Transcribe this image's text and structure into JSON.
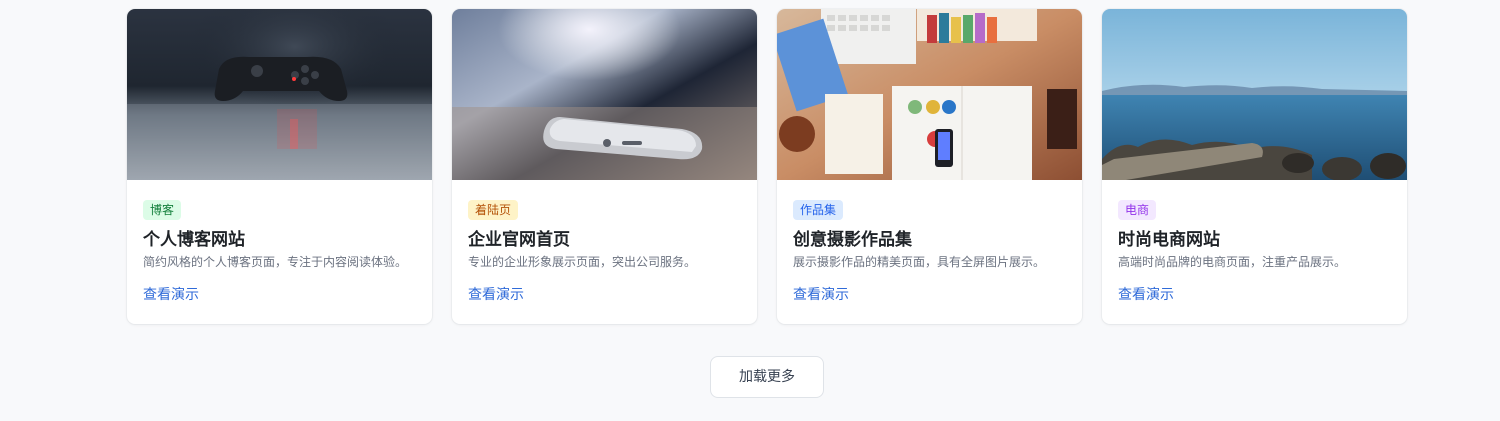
{
  "cards": [
    {
      "tag": "博客",
      "tag_bg": "#dcfce7",
      "tag_fg": "#15803d",
      "title": "个人博客网站",
      "description": "简约风格的个人博客页面，专注于内容阅读体验。",
      "link": "查看演示",
      "image_icon": "game-controller-image"
    },
    {
      "tag": "着陆页",
      "tag_bg": "#fef3c7",
      "tag_fg": "#b45309",
      "title": "企业官网首页",
      "description": "专业的企业形象展示页面，突出公司服务。",
      "link": "查看演示",
      "image_icon": "smartphone-image"
    },
    {
      "tag": "作品集",
      "tag_bg": "#dbeafe",
      "tag_fg": "#2563eb",
      "title": "创意摄影作品集",
      "description": "展示摄影作品的精美页面，具有全屏图片展示。",
      "link": "查看演示",
      "image_icon": "desk-workspace-image"
    },
    {
      "tag": "电商",
      "tag_bg": "#f3e8ff",
      "tag_fg": "#9333ea",
      "title": "时尚电商网站",
      "description": "高端时尚品牌的电商页面，注重产品展示。",
      "link": "查看演示",
      "image_icon": "ocean-coast-image"
    }
  ],
  "load_more_label": "加载更多",
  "link_color": "#2f6ad8",
  "page_background": "#f8f9fb"
}
